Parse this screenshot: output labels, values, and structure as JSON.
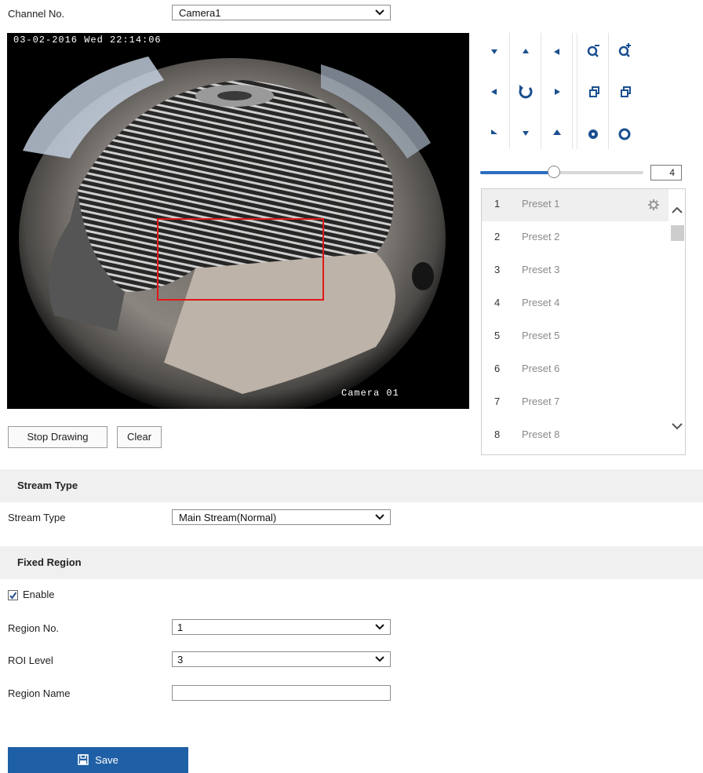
{
  "channel": {
    "label": "Channel No.",
    "value": "Camera1"
  },
  "video": {
    "timestamp": "03-02-2016 Wed 22:14:06",
    "camera_label": "Camera 01"
  },
  "drawing": {
    "stop_label": "Stop Drawing",
    "clear_label": "Clear"
  },
  "ptz": {
    "speed_value": "4",
    "speed_fraction": 0.45
  },
  "presets": [
    {
      "num": "1",
      "name": "Preset 1"
    },
    {
      "num": "2",
      "name": "Preset 2"
    },
    {
      "num": "3",
      "name": "Preset 3"
    },
    {
      "num": "4",
      "name": "Preset 4"
    },
    {
      "num": "5",
      "name": "Preset 5"
    },
    {
      "num": "6",
      "name": "Preset 6"
    },
    {
      "num": "7",
      "name": "Preset 7"
    },
    {
      "num": "8",
      "name": "Preset 8"
    }
  ],
  "stream": {
    "section_title": "Stream Type",
    "label": "Stream Type",
    "value": "Main Stream(Normal)"
  },
  "fixed_region": {
    "section_title": "Fixed Region",
    "enable_label": "Enable",
    "enable_checked": true,
    "region_no_label": "Region No.",
    "region_no_value": "1",
    "roi_level_label": "ROI Level",
    "roi_level_value": "3",
    "region_name_label": "Region Name",
    "region_name_value": ""
  },
  "save_label": "Save",
  "colors": {
    "accent": "#1f5fa6",
    "roi_box": "#e01818",
    "slider": "#2a6fc0"
  }
}
